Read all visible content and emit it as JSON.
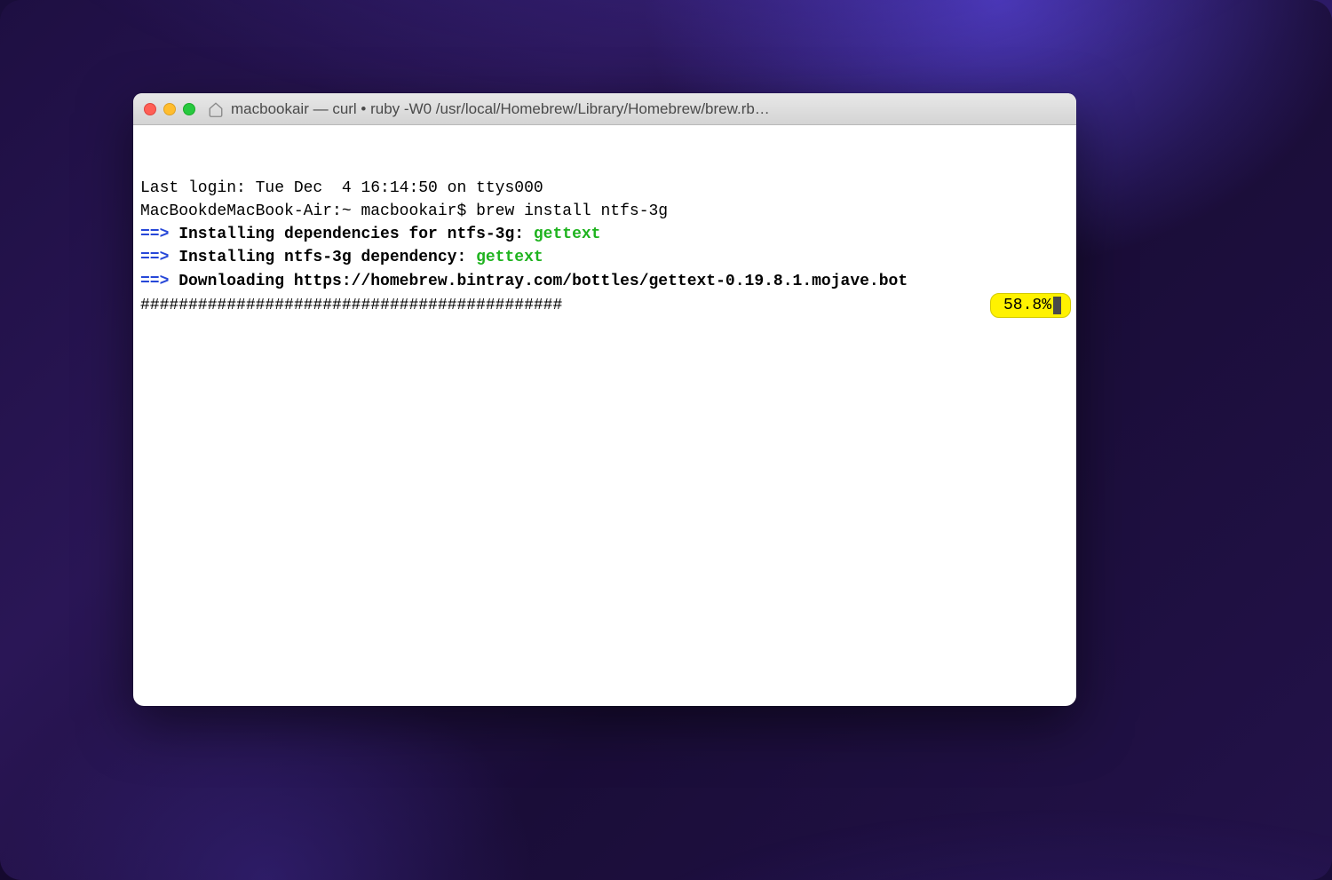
{
  "window": {
    "title": "macbookair — curl • ruby -W0 /usr/local/Homebrew/Library/Homebrew/brew.rb…"
  },
  "terminal": {
    "line1": "Last login: Tue Dec  4 16:14:50 on ttys000",
    "line2_prompt": "MacBookdeMacBook-Air:~ macbookair$ ",
    "line2_cmd": "brew install ntfs-3g",
    "line3_arrow": "==>",
    "line3_text": " Installing dependencies for ntfs-3g: ",
    "line3_dep": "gettext",
    "line4_arrow": "==>",
    "line4_text": " Installing ntfs-3g dependency: ",
    "line4_dep": "gettext",
    "line5_arrow": "==>",
    "line5_text": " Downloading https://homebrew.bintray.com/bottles/gettext-0.19.8.1.mojave.bot",
    "progress_hashes": "############################################",
    "progress_percent": "58.8%"
  },
  "colors": {
    "traffic_close": "#ff5f56",
    "traffic_minimize": "#ffbd2e",
    "traffic_zoom": "#27c93f",
    "highlight": "#fff200",
    "green": "#1fb31f",
    "blue": "#2647d8"
  }
}
